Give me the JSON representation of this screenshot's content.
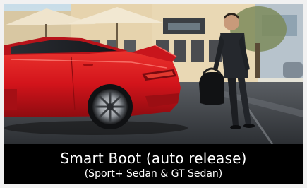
{
  "caption": {
    "title": "Smart Boot (auto release)",
    "subtitle": "(Sport+ Sedan & GT Sedan)"
  },
  "photo": {
    "subject": "red-sedan-with-open-boot-and-man-with-bag",
    "colors": {
      "car_red": "#d6161c",
      "sky": "#cfe3ef",
      "pavement": "#3f4348",
      "building": "#e2cfa8"
    }
  }
}
